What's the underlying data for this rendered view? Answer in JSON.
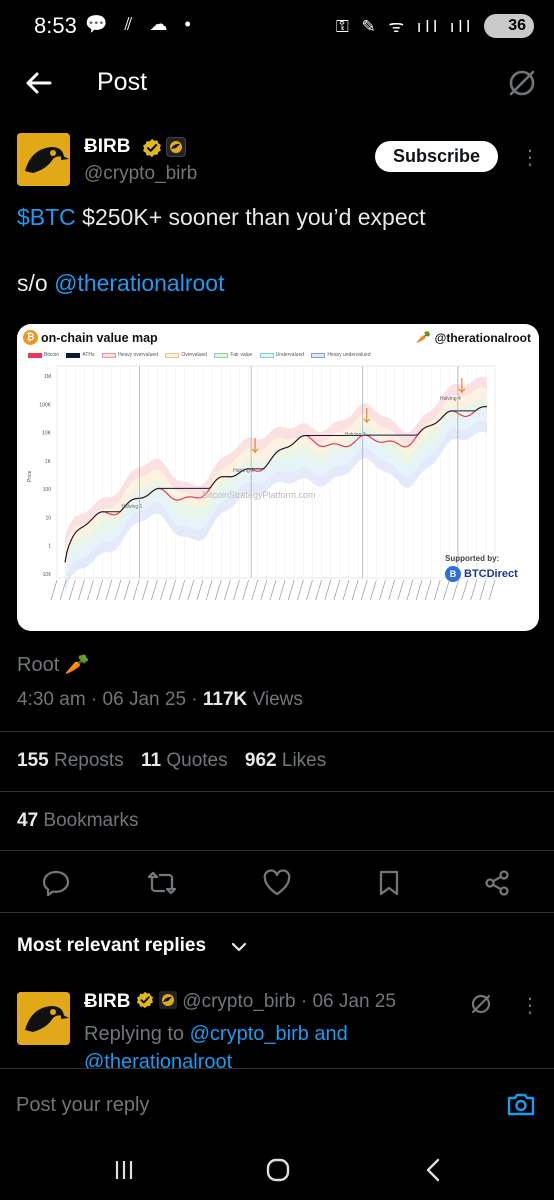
{
  "status_bar": {
    "time": "8:53",
    "left_icons": "💬 ⫽ ☁ •",
    "right_icons": "⚿ ✎ ᯤ ıll ıll",
    "battery": "36"
  },
  "header": {
    "title": "Post"
  },
  "post": {
    "author_name": "ɃIRB",
    "handle": "@crypto_birb",
    "subscribe_label": "Subscribe",
    "text_cashtag": "$BTC",
    "text_rest": " $250K+ sooner than you’d expect",
    "shoutout_prefix": "s/o ",
    "shoutout_mention": "@therationalroot",
    "card": {
      "title": "on-chain value map",
      "btc_symbol": "₿",
      "handle": "@therationalroot",
      "carrot": "🥕",
      "legend": [
        "Bitcoin",
        "ATHs",
        "Heavy overvalued",
        "Overvalued",
        "Fair value",
        "Undervalued",
        "Heavy undervalued"
      ],
      "supported_by": "Supported by:",
      "sponsor": "BTCDirect",
      "sponsor_icon": "B",
      "watermark": "BitcoinStrategyPlatform.com"
    },
    "translation_note": "Root 🥕",
    "time": "4:30 am",
    "date": "06 Jan 25",
    "views_count": "117K",
    "views_label": "Views",
    "reposts_count": "155",
    "reposts_label": "Reposts",
    "quotes_count": "11",
    "quotes_label": "Quotes",
    "likes_count": "962",
    "likes_label": "Likes",
    "bookmarks_count": "47",
    "bookmarks_label": "Bookmarks"
  },
  "chart_data": {
    "type": "line",
    "y_scale": "log",
    "y_ticks": [
      "1M",
      "100K",
      "10K",
      "1K",
      "100",
      "10",
      "1",
      "10¢"
    ],
    "ylabel": "Price",
    "annotations": [
      "Halving 1",
      "Halving 2",
      "Halving 3",
      "Halving 4"
    ]
  },
  "replies": {
    "filter_label": "Most relevant replies",
    "first": {
      "author_name": "ɃIRB",
      "handle": "@crypto_birb",
      "date": "06 Jan 25",
      "replying_to_label": "Replying to ",
      "replying_to_1": "@crypto_birb",
      "and_label": " and",
      "replying_to_2": "@therationalroot"
    }
  },
  "compose": {
    "placeholder": "Post your reply"
  },
  "colors": {
    "accent": "#1d9bf0",
    "muted": "#71767b",
    "background": "#000000",
    "avatar_gold": "#e1a917"
  }
}
